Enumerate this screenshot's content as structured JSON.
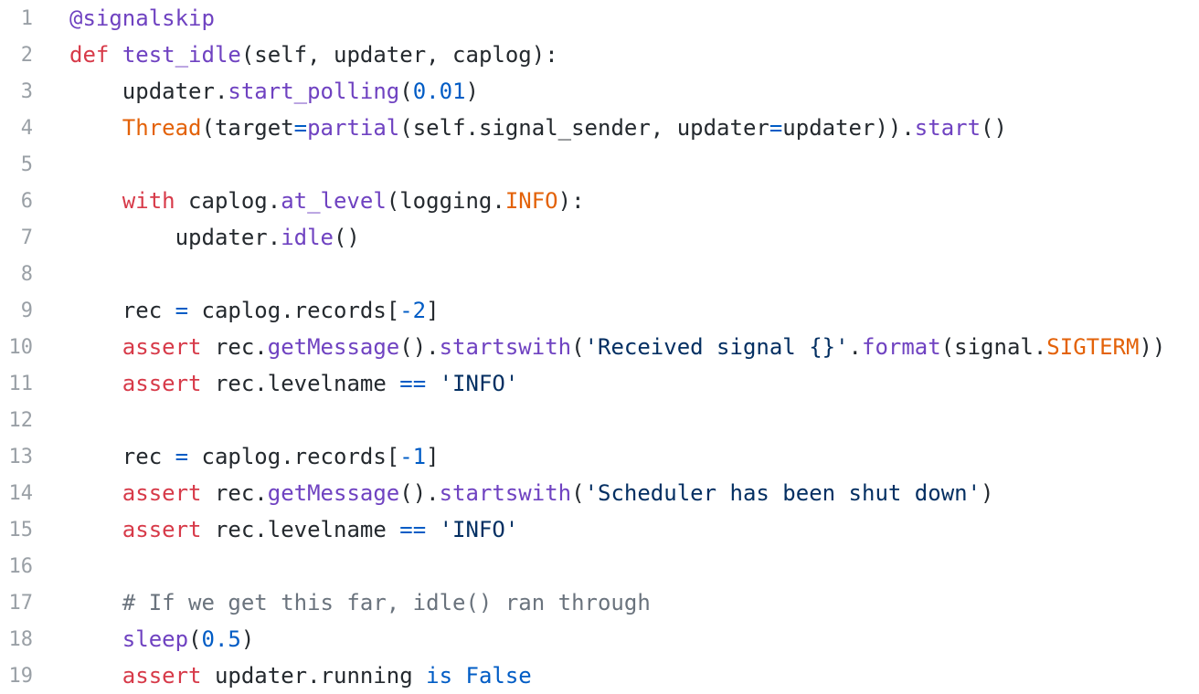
{
  "editor": {
    "colors": {
      "background": "#ffffff",
      "line_number": "#9aa0a6",
      "decorator": "#6f42c1",
      "keyword": "#d73a49",
      "function": "#6f42c1",
      "builtin": "#e36209",
      "number": "#005cc5",
      "operator": "#005cc5",
      "string": "#032f62",
      "comment": "#6a737d",
      "plain": "#24292e"
    },
    "lines": [
      {
        "number": "1",
        "indent": "",
        "tokens": [
          {
            "text": "@signalskip",
            "kind": "decorator"
          }
        ]
      },
      {
        "number": "2",
        "indent": "",
        "tokens": [
          {
            "text": "def",
            "kind": "keyword"
          },
          {
            "text": " ",
            "kind": "plain"
          },
          {
            "text": "test_idle",
            "kind": "funcdef"
          },
          {
            "text": "(self, updater, caplog):",
            "kind": "plain"
          }
        ]
      },
      {
        "number": "3",
        "indent": "    ",
        "tokens": [
          {
            "text": "updater.",
            "kind": "plain"
          },
          {
            "text": "start_polling",
            "kind": "call"
          },
          {
            "text": "(",
            "kind": "plain"
          },
          {
            "text": "0.01",
            "kind": "number"
          },
          {
            "text": ")",
            "kind": "plain"
          }
        ]
      },
      {
        "number": "4",
        "indent": "    ",
        "tokens": [
          {
            "text": "Thread",
            "kind": "builtin"
          },
          {
            "text": "(target",
            "kind": "plain"
          },
          {
            "text": "=",
            "kind": "operator"
          },
          {
            "text": "partial",
            "kind": "call"
          },
          {
            "text": "(self.signal_sender, updater",
            "kind": "plain"
          },
          {
            "text": "=",
            "kind": "operator"
          },
          {
            "text": "updater)).",
            "kind": "plain"
          },
          {
            "text": "start",
            "kind": "call"
          },
          {
            "text": "()",
            "kind": "plain"
          }
        ]
      },
      {
        "number": "5",
        "indent": "",
        "tokens": []
      },
      {
        "number": "6",
        "indent": "    ",
        "tokens": [
          {
            "text": "with",
            "kind": "keyword"
          },
          {
            "text": " caplog.",
            "kind": "plain"
          },
          {
            "text": "at_level",
            "kind": "call"
          },
          {
            "text": "(logging.",
            "kind": "plain"
          },
          {
            "text": "INFO",
            "kind": "builtin"
          },
          {
            "text": "):",
            "kind": "plain"
          }
        ]
      },
      {
        "number": "7",
        "indent": "        ",
        "tokens": [
          {
            "text": "updater.",
            "kind": "plain"
          },
          {
            "text": "idle",
            "kind": "call"
          },
          {
            "text": "()",
            "kind": "plain"
          }
        ]
      },
      {
        "number": "8",
        "indent": "",
        "tokens": []
      },
      {
        "number": "9",
        "indent": "    ",
        "tokens": [
          {
            "text": "rec ",
            "kind": "plain"
          },
          {
            "text": "=",
            "kind": "operator"
          },
          {
            "text": " caplog.records[",
            "kind": "plain"
          },
          {
            "text": "-2",
            "kind": "number"
          },
          {
            "text": "]",
            "kind": "plain"
          }
        ]
      },
      {
        "number": "10",
        "indent": "    ",
        "tokens": [
          {
            "text": "assert",
            "kind": "keyword"
          },
          {
            "text": " rec.",
            "kind": "plain"
          },
          {
            "text": "getMessage",
            "kind": "call"
          },
          {
            "text": "().",
            "kind": "plain"
          },
          {
            "text": "startswith",
            "kind": "call"
          },
          {
            "text": "(",
            "kind": "plain"
          },
          {
            "text": "'Received signal {}'",
            "kind": "string"
          },
          {
            "text": ".",
            "kind": "plain"
          },
          {
            "text": "format",
            "kind": "call"
          },
          {
            "text": "(signal.",
            "kind": "plain"
          },
          {
            "text": "SIGTERM",
            "kind": "builtin"
          },
          {
            "text": "))",
            "kind": "plain"
          }
        ]
      },
      {
        "number": "11",
        "indent": "    ",
        "tokens": [
          {
            "text": "assert",
            "kind": "keyword"
          },
          {
            "text": " rec.levelname ",
            "kind": "plain"
          },
          {
            "text": "==",
            "kind": "operator"
          },
          {
            "text": " ",
            "kind": "plain"
          },
          {
            "text": "'INFO'",
            "kind": "string"
          }
        ]
      },
      {
        "number": "12",
        "indent": "",
        "tokens": []
      },
      {
        "number": "13",
        "indent": "    ",
        "tokens": [
          {
            "text": "rec ",
            "kind": "plain"
          },
          {
            "text": "=",
            "kind": "operator"
          },
          {
            "text": " caplog.records[",
            "kind": "plain"
          },
          {
            "text": "-1",
            "kind": "number"
          },
          {
            "text": "]",
            "kind": "plain"
          }
        ]
      },
      {
        "number": "14",
        "indent": "    ",
        "tokens": [
          {
            "text": "assert",
            "kind": "keyword"
          },
          {
            "text": " rec.",
            "kind": "plain"
          },
          {
            "text": "getMessage",
            "kind": "call"
          },
          {
            "text": "().",
            "kind": "plain"
          },
          {
            "text": "startswith",
            "kind": "call"
          },
          {
            "text": "(",
            "kind": "plain"
          },
          {
            "text": "'Scheduler has been shut down'",
            "kind": "string"
          },
          {
            "text": ")",
            "kind": "plain"
          }
        ]
      },
      {
        "number": "15",
        "indent": "    ",
        "tokens": [
          {
            "text": "assert",
            "kind": "keyword"
          },
          {
            "text": " rec.levelname ",
            "kind": "plain"
          },
          {
            "text": "==",
            "kind": "operator"
          },
          {
            "text": " ",
            "kind": "plain"
          },
          {
            "text": "'INFO'",
            "kind": "string"
          }
        ]
      },
      {
        "number": "16",
        "indent": "",
        "tokens": []
      },
      {
        "number": "17",
        "indent": "    ",
        "tokens": [
          {
            "text": "# If we get this far, idle() ran through",
            "kind": "comment"
          }
        ]
      },
      {
        "number": "18",
        "indent": "    ",
        "tokens": [
          {
            "text": "sleep",
            "kind": "call"
          },
          {
            "text": "(",
            "kind": "plain"
          },
          {
            "text": "0.5",
            "kind": "number"
          },
          {
            "text": ")",
            "kind": "plain"
          }
        ]
      },
      {
        "number": "19",
        "indent": "    ",
        "tokens": [
          {
            "text": "assert",
            "kind": "keyword"
          },
          {
            "text": " updater.running ",
            "kind": "plain"
          },
          {
            "text": "is",
            "kind": "operator"
          },
          {
            "text": " ",
            "kind": "plain"
          },
          {
            "text": "False",
            "kind": "const"
          }
        ]
      }
    ]
  }
}
